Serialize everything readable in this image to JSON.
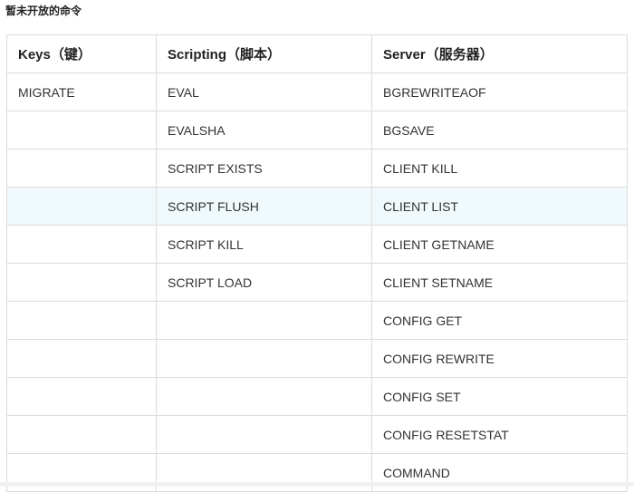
{
  "caption": "暂未开放的命令",
  "table": {
    "headers": [
      "Keys（键）",
      "Scripting（脚本）",
      "Server（服务器）"
    ],
    "highlight_row": 3,
    "rows": [
      [
        "MIGRATE",
        "EVAL",
        "BGREWRITEAOF"
      ],
      [
        "",
        "EVALSHA",
        "BGSAVE"
      ],
      [
        "",
        "SCRIPT EXISTS",
        "CLIENT KILL"
      ],
      [
        "",
        "SCRIPT FLUSH",
        "CLIENT LIST"
      ],
      [
        "",
        "SCRIPT KILL",
        "CLIENT GETNAME"
      ],
      [
        "",
        "SCRIPT LOAD",
        "CLIENT SETNAME"
      ],
      [
        "",
        "",
        "CONFIG GET"
      ],
      [
        "",
        "",
        "CONFIG REWRITE"
      ],
      [
        "",
        "",
        "CONFIG SET"
      ],
      [
        "",
        "",
        "CONFIG RESETSTAT"
      ],
      [
        "",
        "",
        "COMMAND"
      ]
    ]
  }
}
